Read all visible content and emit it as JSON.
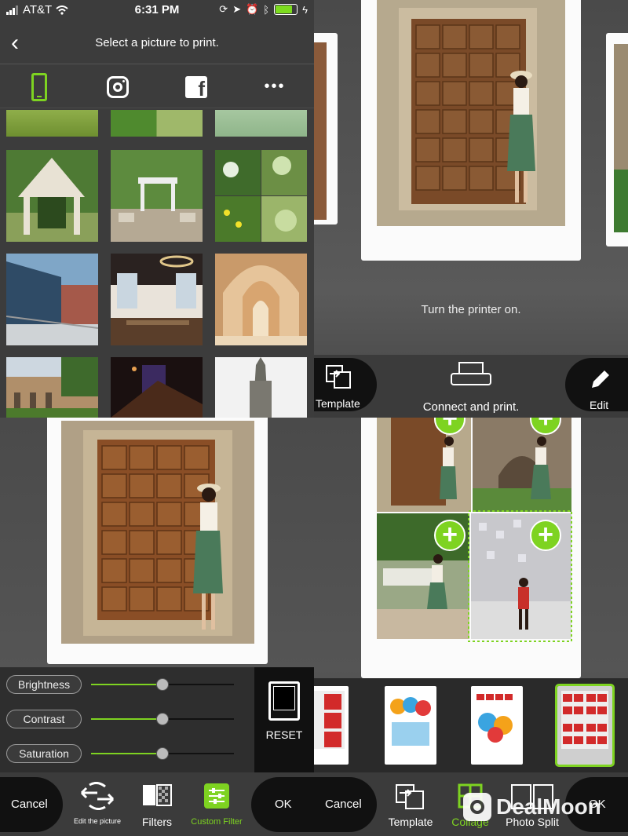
{
  "status": {
    "carrier": "AT&T",
    "time": "6:31 PM"
  },
  "select_screen": {
    "title": "Select a picture to print.",
    "sources": [
      "phone-icon",
      "instagram-icon",
      "facebook-icon",
      "more-icon"
    ],
    "more_label": "•••",
    "fb_label": "f"
  },
  "print_screen": {
    "message": "Turn the printer on.",
    "template_label": "Template",
    "connect_label": "Connect and print.",
    "edit_label": "Edit"
  },
  "filter_screen": {
    "sliders": [
      {
        "label": "Brightness",
        "value": 0.5
      },
      {
        "label": "Contrast",
        "value": 0.5
      },
      {
        "label": "Saturation",
        "value": 0.5
      }
    ],
    "reset_label": "RESET",
    "toolbar": {
      "cancel": "Cancel",
      "edit": "Edit the picture",
      "filters": "Filters",
      "custom": "Custom Filter",
      "ok": "OK"
    }
  },
  "collage_screen": {
    "toolbar": {
      "cancel": "Cancel",
      "template": "Template",
      "collage": "Collage",
      "split": "Photo Split",
      "ok": "OK"
    }
  },
  "watermark": "DealMoon",
  "colors": {
    "accent": "#7ed321",
    "background": "#3a3a3a"
  }
}
